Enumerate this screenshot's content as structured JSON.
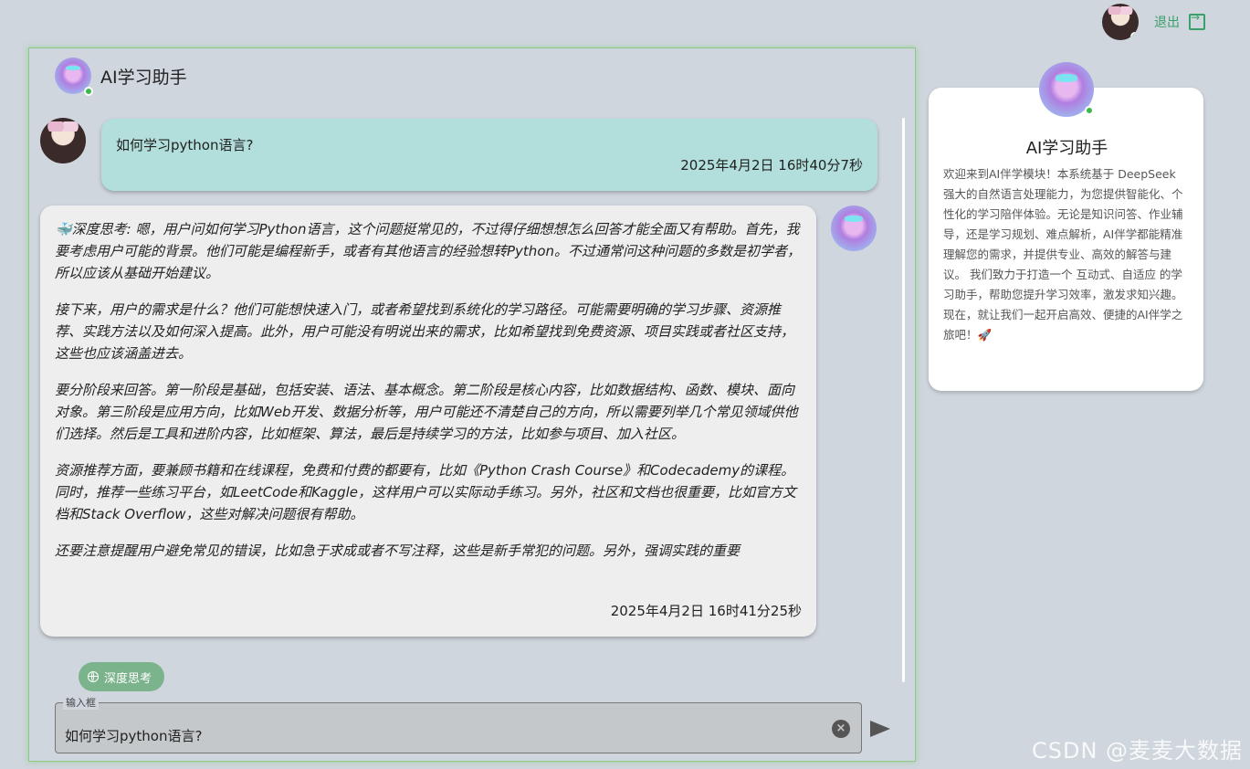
{
  "topbar": {
    "logout_label": "退出"
  },
  "chat": {
    "header_title": "AI学习助手",
    "user_message": {
      "text": "如何学习python语言?",
      "time": "2025年4月2日 16时40分7秒"
    },
    "bot_message": {
      "paragraphs": [
        "🐳深度思考: 嗯，用户问如何学习Python语言，这个问题挺常见的，不过得仔细想想怎么回答才能全面又有帮助。首先，我要考虑用户可能的背景。他们可能是编程新手，或者有其他语言的经验想转Python。不过通常问这种问题的多数是初学者，所以应该从基础开始建议。",
        "接下来，用户的需求是什么？他们可能想快速入门，或者希望找到系统化的学习路径。可能需要明确的学习步骤、资源推荐、实践方法以及如何深入提高。此外，用户可能没有明说出来的需求，比如希望找到免费资源、项目实践或者社区支持，这些也应该涵盖进去。",
        "要分阶段来回答。第一阶段是基础，包括安装、语法、基本概念。第二阶段是核心内容，比如数据结构、函数、模块、面向对象。第三阶段是应用方向，比如Web开发、数据分析等，用户可能还不清楚自己的方向，所以需要列举几个常见领域供他们选择。然后是工具和进阶内容，比如框架、算法，最后是持续学习的方法，比如参与项目、加入社区。",
        "资源推荐方面，要兼顾书籍和在线课程，免费和付费的都要有，比如《Python Crash Course》和Codecademy的课程。同时，推荐一些练习平台，如LeetCode和Kaggle，这样用户可以实际动手练习。另外，社区和文档也很重要，比如官方文档和Stack Overflow，这些对解决问题很有帮助。",
        "还要注意提醒用户避免常见的错误，比如急于求成或者不写注释，这些是新手常犯的问题。另外，强调实践的重要"
      ],
      "time": "2025年4月2日 16时41分25秒"
    },
    "deep_think_label": "深度思考",
    "input": {
      "label": "输入框",
      "value": "如何学习python语言?"
    }
  },
  "info_card": {
    "title": "AI学习助手",
    "description": "欢迎来到AI伴学模块！本系统基于 DeepSeek 强大的自然语言处理能力，为您提供智能化、个性化的学习陪伴体验。无论是知识问答、作业辅导，还是学习规划、难点解析，AI伴学都能精准理解您的需求，并提供专业、高效的解答与建议。 我们致力于打造一个 互动式、自适应 的学习助手，帮助您提升学习效率，激发求知兴趣。现在，就让我们一起开启高效、便捷的AI伴学之旅吧！🚀"
  },
  "watermark": "CSDN @麦麦大数据"
}
